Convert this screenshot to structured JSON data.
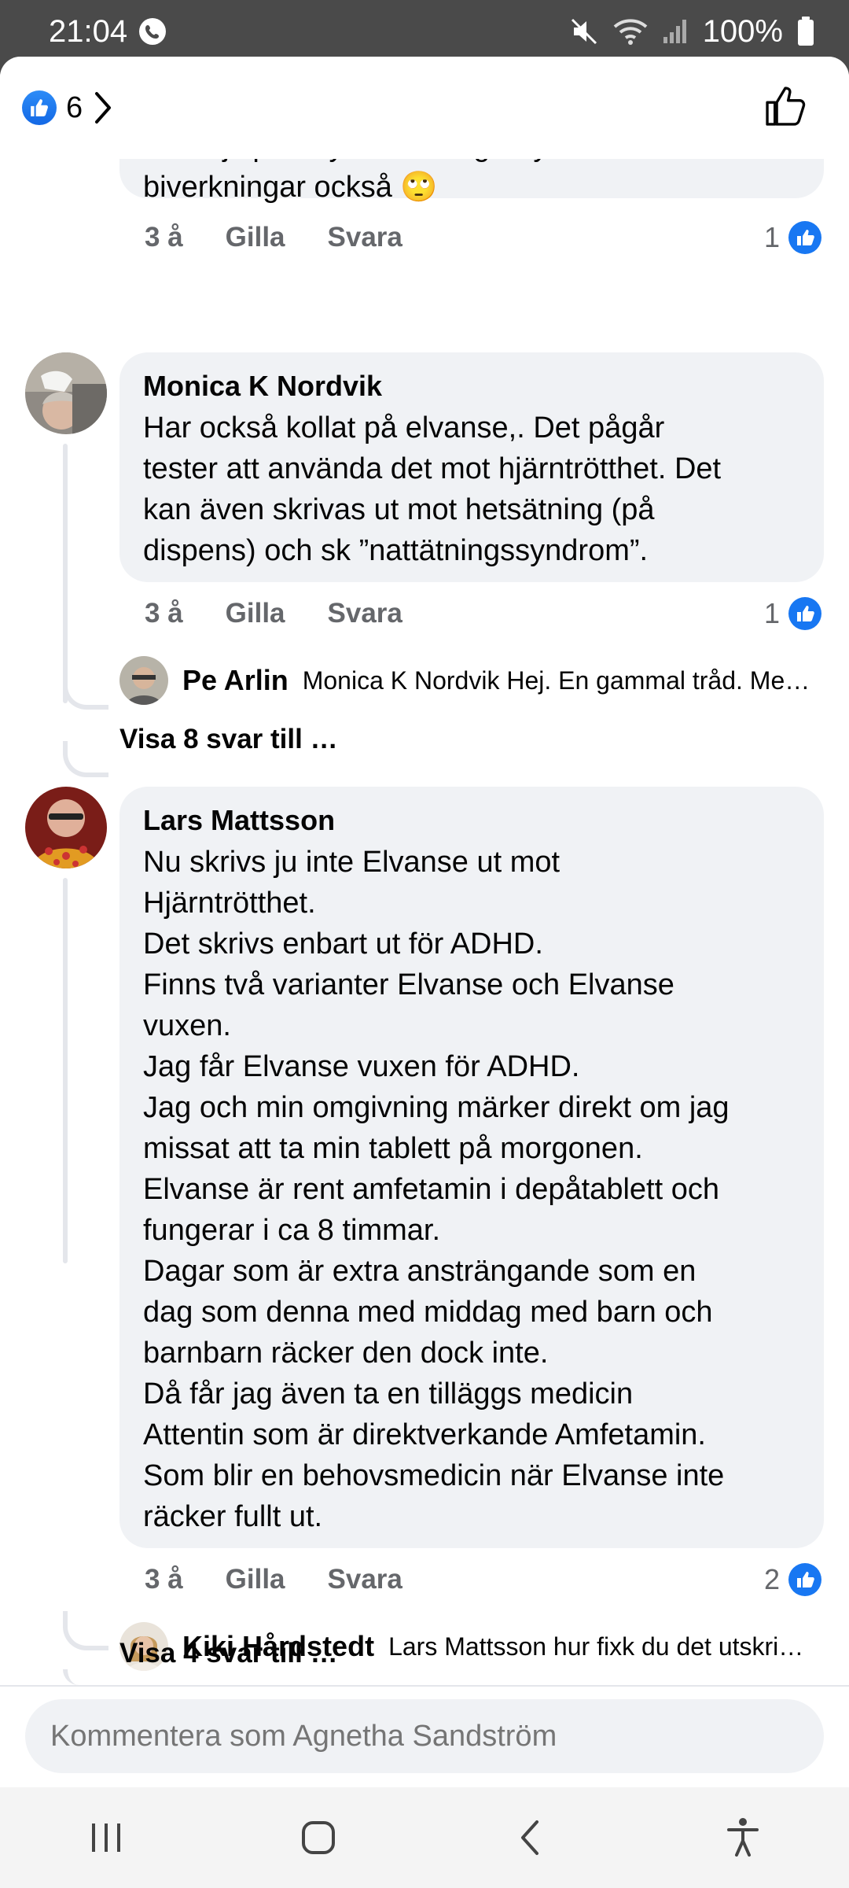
{
  "status_bar": {
    "time": "21:04",
    "battery": "100%"
  },
  "header": {
    "reaction_count": "6"
  },
  "comments": [
    {
      "text_partial": "Den hjälper mycket men ger tyvärr en massa\nbiverkningar också 🙄",
      "time": "3 å",
      "like": "Gilla",
      "reply": "Svara",
      "reactions": "1"
    },
    {
      "author": "Monica K Nordvik",
      "text": "Har också kollat på elvanse,. Det pågår\ntester att använda det mot hjärntrötthet. Det\nkan även skrivas ut mot hetsätning (på\ndispens) och sk ”nattätningssyndrom”.",
      "time": "3 å",
      "like": "Gilla",
      "reply": "Svara",
      "reactions": "1",
      "reply_preview": {
        "name": "Pe Arlin",
        "snippet": "Monica K Nordvik Hej. En gammal tråd. Me…"
      },
      "more_replies": "Visa 8 svar till …"
    },
    {
      "author": "Lars Mattsson",
      "text": "Nu skrivs ju inte Elvanse ut mot\nHjärntrötthet.\nDet skrivs enbart ut för ADHD.\nFinns två varianter Elvanse och Elvanse\nvuxen.\nJag får Elvanse vuxen för ADHD.\nJag och min omgivning märker direkt om jag\nmissat att ta min tablett på morgonen.\nElvanse är rent amfetamin i depåtablett och\nfungerar i ca 8 timmar.\nDagar som är extra ansträngande som en\ndag som denna med middag med barn och\nbarnbarn räcker den dock inte.\nDå får jag även ta en tilläggs medicin\nAttentin som är direktverkande Amfetamin.\nSom blir en behovsmedicin när Elvanse inte\nräcker fullt ut.",
      "time": "3 å",
      "like": "Gilla",
      "reply": "Svara",
      "reactions": "2",
      "reply_preview": {
        "name": "Kiki Hårdstedt",
        "snippet": "Lars Mattsson hur fixk du det utskri…"
      },
      "more_replies": "Visa 4 svar till …"
    }
  ],
  "composer": {
    "placeholder": "Kommentera som Agnetha Sandström"
  },
  "colors": {
    "accent": "#1877f2",
    "bubble": "#f0f2f5",
    "muted": "#65676b"
  }
}
